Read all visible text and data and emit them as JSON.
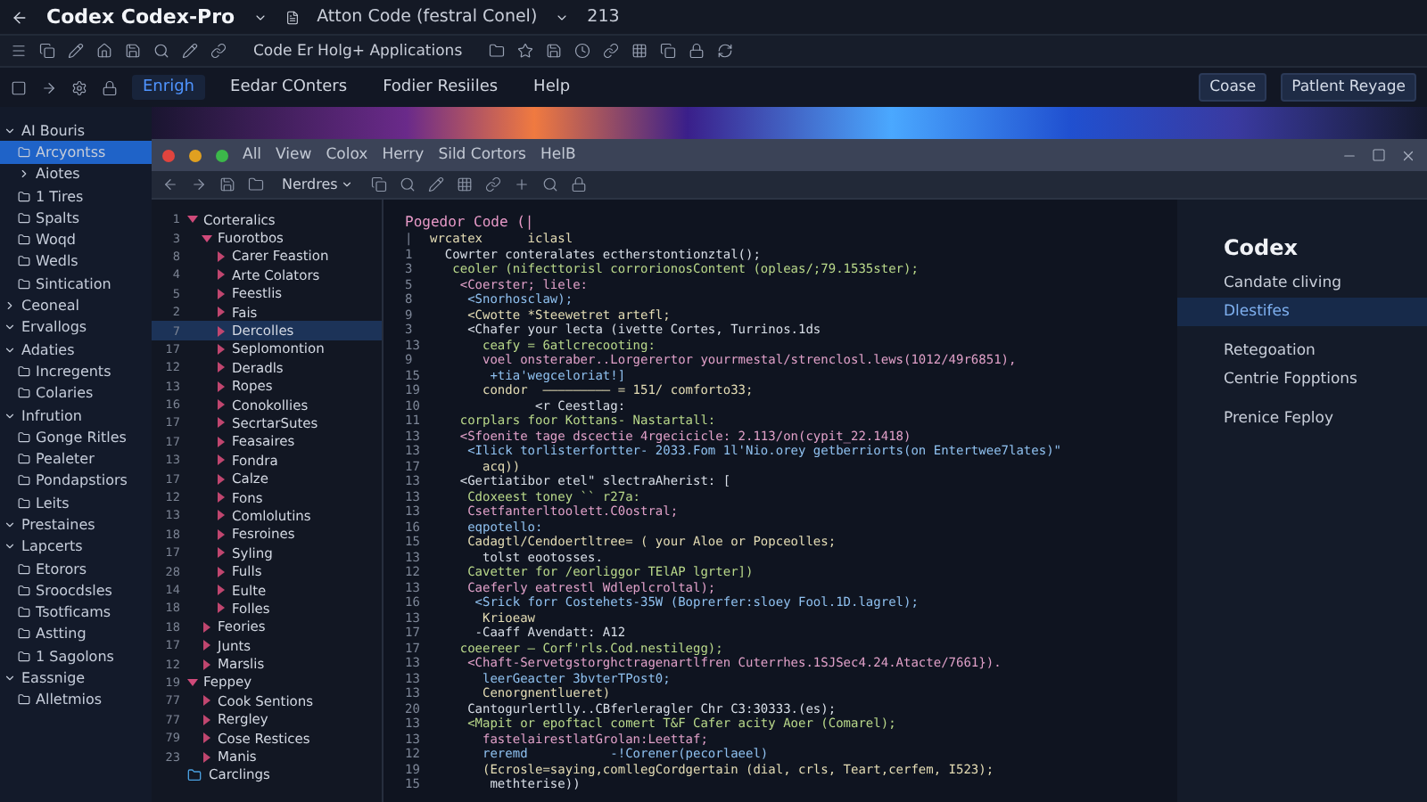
{
  "app": {
    "title": "Codex Codex-Pro",
    "tab": "Atton Code (festral Conel)",
    "count": "213"
  },
  "toolbar": {
    "label": "Code Er Holg+ Applications"
  },
  "menu": {
    "items": [
      {
        "label": "Enrigh",
        "selected": true
      },
      {
        "label": "Eedar COnters",
        "selected": false
      },
      {
        "label": "Fodier Resiiles",
        "selected": false
      },
      {
        "label": "Help",
        "selected": false
      }
    ],
    "buttons": [
      "Coase",
      "Patlent Reyage"
    ]
  },
  "sidebar": {
    "items": [
      {
        "label": "AI Bouris",
        "selected": false,
        "expanded": true,
        "children": [
          {
            "label": "Arcyontss",
            "selected": true
          },
          {
            "label": "Aiotes",
            "selected": false,
            "expanded": false
          },
          {
            "label": "1 Tires",
            "selected": false
          },
          {
            "label": "Spalts",
            "selected": false
          },
          {
            "label": "Woqd",
            "selected": false
          },
          {
            "label": "Wedls",
            "selected": false
          },
          {
            "label": "Sintication",
            "selected": false
          }
        ]
      },
      {
        "label": "Ceoneal",
        "selected": false,
        "expanded": false
      },
      {
        "label": "Ervallogs",
        "selected": false,
        "expanded": true
      },
      {
        "label": "Adaties",
        "selected": false,
        "expanded": true,
        "children": [
          {
            "label": "Incregents",
            "selected": false
          },
          {
            "label": "Colaries",
            "selected": false
          }
        ]
      },
      {
        "label": "Infrution",
        "selected": false,
        "expanded": true,
        "children": [
          {
            "label": "Gonge Ritles",
            "selected": false
          },
          {
            "label": "Pealeter",
            "selected": false
          },
          {
            "label": "Pondapstiors",
            "selected": false
          },
          {
            "label": "Leits",
            "selected": false
          }
        ]
      },
      {
        "label": "Prestaines",
        "selected": false,
        "expanded": true
      },
      {
        "label": "Lapcerts",
        "selected": false,
        "expanded": true,
        "children": [
          {
            "label": "Etorors",
            "selected": false
          },
          {
            "label": "Sroocdsles",
            "selected": false
          },
          {
            "label": "Tsotficams",
            "selected": false
          },
          {
            "label": "Astting",
            "selected": false
          },
          {
            "label": "1 Sagolons",
            "selected": false
          }
        ]
      },
      {
        "label": "Eassnige",
        "selected": false,
        "expanded": true,
        "children": [
          {
            "label": "Alletmios",
            "selected": false
          }
        ]
      }
    ]
  },
  "window": {
    "menu": [
      "All",
      "View",
      "Colox",
      "Herry",
      "Sild Cortors",
      "HelB"
    ],
    "dropdown": "Nerdres"
  },
  "tree": {
    "rows": [
      {
        "kind": "branch",
        "num": "1",
        "label": "Corteralics",
        "selected": false,
        "expanded": true,
        "children": [
          {
            "num": "3",
            "label": "Fuorotbos",
            "selected": false,
            "expanded": true,
            "children": [
              {
                "num": "8",
                "label": "Carer Feastion",
                "selected": false
              },
              {
                "num": "4",
                "label": "Arte Colators",
                "selected": false
              },
              {
                "num": "5",
                "label": "Feestlis",
                "selected": false
              },
              {
                "num": "2",
                "label": "Fais",
                "selected": false
              },
              {
                "num": "7",
                "label": "Dercolles",
                "selected": true
              },
              {
                "num": "17",
                "label": "Seplomontion",
                "selected": false
              },
              {
                "num": "12",
                "label": "Deradls",
                "selected": false
              },
              {
                "num": "13",
                "label": "Ropes",
                "selected": false
              },
              {
                "num": "16",
                "label": "Conokollies",
                "selected": false
              },
              {
                "num": "17",
                "label": "SecrtarSutes",
                "selected": false
              },
              {
                "num": "17",
                "label": "Feasaires",
                "selected": false
              },
              {
                "num": "13",
                "label": "Fondra",
                "selected": false
              },
              {
                "num": "17",
                "label": "Calze",
                "selected": false
              },
              {
                "num": "12",
                "label": "Fons",
                "selected": false
              },
              {
                "num": "13",
                "label": "Comlolutins",
                "selected": false
              },
              {
                "num": "18",
                "label": "Fesroines",
                "selected": false
              },
              {
                "num": "17",
                "label": "Syling",
                "selected": false
              },
              {
                "num": "28",
                "label": "Fulls",
                "selected": false
              },
              {
                "num": "14",
                "label": "Eulte",
                "selected": false
              },
              {
                "num": "18",
                "label": "Folles",
                "selected": false
              }
            ]
          },
          {
            "num": "18",
            "label": "Feories",
            "selected": false
          },
          {
            "num": "17",
            "label": "Junts",
            "selected": false
          },
          {
            "num": "12",
            "label": "Marslis",
            "selected": false
          }
        ]
      },
      {
        "kind": "branch",
        "num": "19",
        "label": "Feppey",
        "selected": false,
        "expanded": true,
        "children": [
          {
            "num": "77",
            "label": "Cook Sentions",
            "selected": false
          },
          {
            "num": "77",
            "label": "Rergley",
            "selected": false
          },
          {
            "num": "79",
            "label": "Cose Restices",
            "selected": false
          },
          {
            "num": "23",
            "label": "Manis",
            "selected": false
          }
        ]
      },
      {
        "kind": "folder",
        "label": "Carclings",
        "selected": false
      }
    ]
  },
  "editor": {
    "title": "Pogedor Code (|",
    "lines": [
      {
        "num": "|",
        "text": "wrcatex      iclasl"
      },
      {
        "num": "1",
        "text": "  Cowrter conteralates ectherstontionztal();"
      },
      {
        "num": "3",
        "text": "   ceoler (nifecttorisl corrorionosContent (opleas/;79.1535ster);"
      },
      {
        "num": "5",
        "text": "    <Coerster; liele:"
      },
      {
        "num": "8",
        "text": "     <Snorhosclaw);"
      },
      {
        "num": "9",
        "text": "     <Cwotte *Steewetret artefl;"
      },
      {
        "num": "3",
        "text": "     <Chafer your lecta (ivette Cortes, Turrinos.1ds"
      },
      {
        "num": "13",
        "text": "       ceafy = 6atlcrecooting:"
      },
      {
        "num": "9",
        "text": "       voel onsteraber..Lorgerertor yourrmestal/strenclosl.lews(1012/49r6851),"
      },
      {
        "num": "15",
        "text": "        +tia'wegceloriat!]"
      },
      {
        "num": "19",
        "text": "       condor  ————————— = 151/ comforto33;"
      },
      {
        "num": "10",
        "text": "              <r Ceestlag:"
      },
      {
        "num": "11",
        "text": "    corplars foor Kottans- Nastartall:"
      },
      {
        "num": "13",
        "text": "    <Sfoenite tage dscectie 4rgecicicle: 2.113/on(cypit_22.1418)"
      },
      {
        "num": "13",
        "text": "     <Ilick torlisterfortter- 2033.Fom 1l'Nio.orey getberriorts(on Entertwee7lates)\""
      },
      {
        "num": "17",
        "text": "       acq))"
      },
      {
        "num": "13",
        "text": "    <Gertiatibor etel\" slectraAherist: ["
      },
      {
        "num": "13",
        "text": "     Cdoxeest toney `` r27a:"
      },
      {
        "num": "13",
        "text": "     Csetfanterltoolett.C0ostral;"
      },
      {
        "num": "16",
        "text": "     eqpotello:"
      },
      {
        "num": "15",
        "text": "     Cadagtl/Cendoertltree= ( your Aloe or Popceolles;"
      },
      {
        "num": "13",
        "text": "       tolst eootosses."
      },
      {
        "num": "12",
        "text": "     Cavetter for /eorliggor TElAP lgrter])"
      },
      {
        "num": "13",
        "text": "     Caeferly eatrestl Wdleplcroltal);"
      },
      {
        "num": "16",
        "text": "      <Srick forr Costehets-35W (Boprerfer:sloey Fool.1D.lagrel);"
      },
      {
        "num": "13",
        "text": "       Krioeaw"
      },
      {
        "num": "17",
        "text": "      -Caaff Avendatt: A12"
      },
      {
        "num": "17",
        "text": "    coeereer — Corf'rls.Cod.nestilegg);"
      },
      {
        "num": "13",
        "text": "     <Chaft-Servetgstorghctragenartlfren Cuterrhes.1SJSec4.24.Atacte/7661})."
      },
      {
        "num": "13",
        "text": "       leerGeacter 3bvterTPost0;"
      },
      {
        "num": "13",
        "text": "       Cenorgnentlueret)"
      },
      {
        "num": "20",
        "text": "     Cantogurlertlly..CBferleragler Chr C3:30333.(es);"
      },
      {
        "num": "13",
        "text": "     <Mapit or epoftacl comert T&F Cafer acity Aoer (Comarel);"
      },
      {
        "num": "13",
        "text": "       fastelairestlatGrolan:Leettaf;"
      },
      {
        "num": "12",
        "text": "       reremd           -!Corener(pecorlaeel)"
      },
      {
        "num": "19",
        "text": "       (Ecrosle=saying,comllegCordgertain (dial, crls, Teart,cerfem, I523);"
      },
      {
        "num": "15",
        "text": "        methterise))"
      }
    ]
  },
  "panel": {
    "title": "Codex",
    "items": [
      {
        "label": "Candate cliving",
        "selected": false
      },
      {
        "label": "Dlestifes",
        "selected": true
      },
      {
        "label": "Retegoation",
        "selected": false
      },
      {
        "label": "Centrie Fopptions",
        "selected": false
      },
      {
        "label": "Prenice Feploy",
        "selected": false
      }
    ]
  }
}
